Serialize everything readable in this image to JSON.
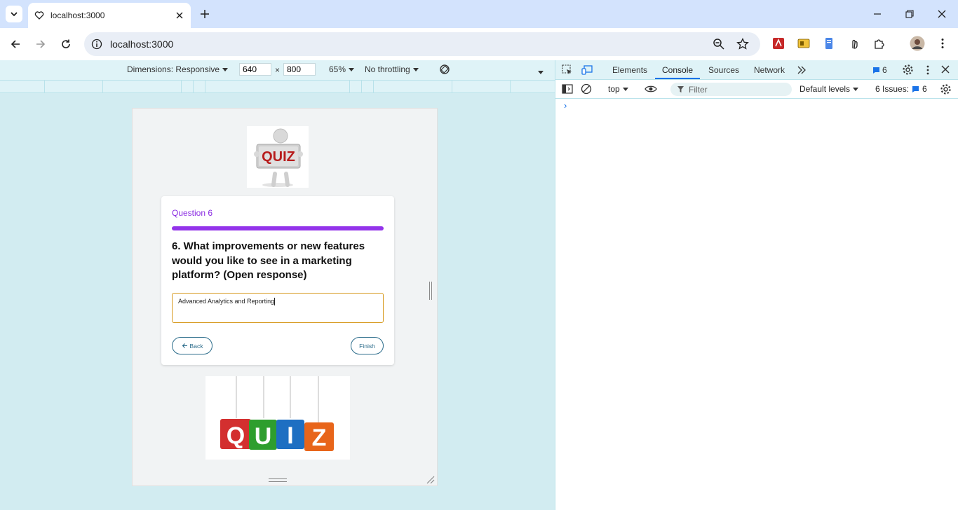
{
  "browser": {
    "tab_title": "localhost:3000",
    "url": "localhost:3000"
  },
  "device_toolbar": {
    "dimensions_label": "Dimensions: Responsive",
    "width": "640",
    "times": "×",
    "height": "800",
    "zoom": "65%",
    "throttling": "No throttling"
  },
  "quiz": {
    "question_label": "Question 6",
    "progress": 1.0,
    "question_text": "6. What improvements or new features would you like to see in a marketing platform? (Open response)",
    "answer_value": "Advanced Analytics and Reporting",
    "back_label": "Back",
    "finish_label": "Finish",
    "top_image_text": "QUIZ",
    "bottom_image_letters": [
      "Q",
      "U",
      "I",
      "Z"
    ]
  },
  "devtools": {
    "tabs": [
      "Elements",
      "Console",
      "Sources",
      "Network"
    ],
    "active_tab": "Console",
    "message_count": "6",
    "context": "top",
    "filter_placeholder": "Filter",
    "levels": "Default levels",
    "issues_label": "6 Issues:",
    "issues_count": "6",
    "prompt": "›"
  },
  "colors": {
    "accent_purple": "#9333ea",
    "input_border": "#d79a1f",
    "button_teal": "#2a6b8a",
    "devtools_blue": "#1a73e8"
  }
}
